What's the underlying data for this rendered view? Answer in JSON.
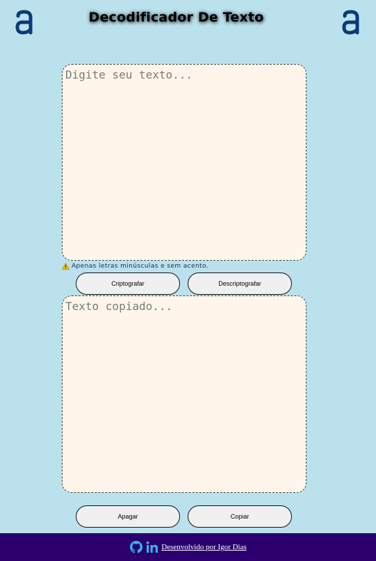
{
  "header": {
    "title": "Decodificador De Texto",
    "logo_icon": "alura-logo-icon"
  },
  "input": {
    "placeholder": "Digite seu texto..."
  },
  "warning": {
    "icon": "warning-icon",
    "text": "Apenas letras minúsculas e sem acento."
  },
  "actions": {
    "encrypt_label": "Criptografar",
    "decrypt_label": "Descriptografar",
    "clear_label": "Apagar",
    "copy_label": "Copiar"
  },
  "output": {
    "placeholder": "Texto copiado..."
  },
  "footer": {
    "credit": "Desenvolvido por Igor Dias",
    "icons": [
      "github-icon",
      "linkedin-icon"
    ]
  },
  "colors": {
    "background": "#bae1ec",
    "textarea_bg": "#fff5ea",
    "logo": "#0a3a78",
    "footer_bg": "#2b006e",
    "footer_icons": "#3ab0f0"
  }
}
